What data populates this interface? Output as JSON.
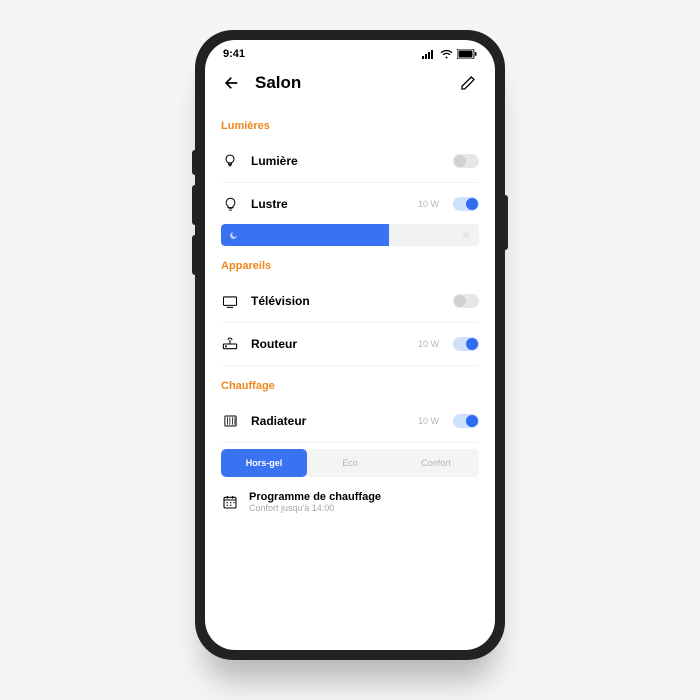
{
  "status": {
    "time": "9:41"
  },
  "header": {
    "title": "Salon"
  },
  "sections": {
    "lights": {
      "label": "Lumières",
      "items": [
        {
          "name": "Lumière",
          "power": "",
          "on": false
        },
        {
          "name": "Lustre",
          "power": "10 W",
          "on": true,
          "brightness": 65
        }
      ]
    },
    "devices": {
      "label": "Appareils",
      "items": [
        {
          "name": "Télévision",
          "power": "",
          "on": false
        },
        {
          "name": "Routeur",
          "power": "10 W",
          "on": true,
          "locked": true
        }
      ]
    },
    "heating": {
      "label": "Chauffage",
      "items": [
        {
          "name": "Radiateur",
          "power": "10 W",
          "on": true
        }
      ],
      "modes": {
        "options": [
          "Hors-gel",
          "Eco",
          "Confort"
        ],
        "active": 0
      },
      "program": {
        "title": "Programme de chauffage",
        "subtitle": "Confort jusqu'à 14:00"
      }
    }
  }
}
